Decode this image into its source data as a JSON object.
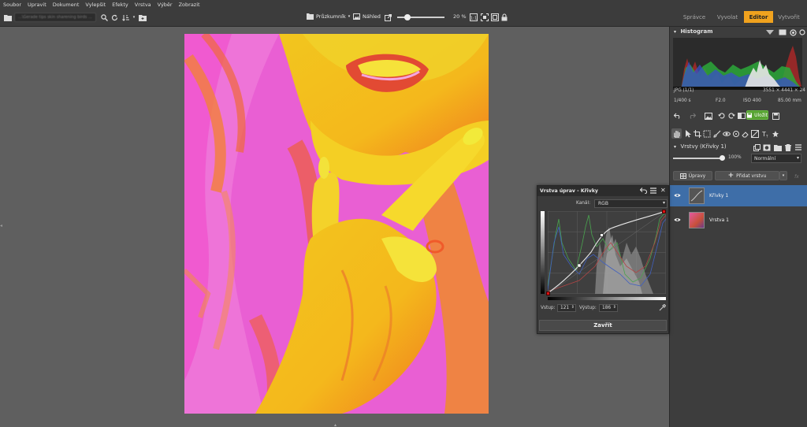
{
  "menu": [
    "Soubor",
    "Upravit",
    "Dokument",
    "Vylepšit",
    "Efekty",
    "Vrstva",
    "Výběr",
    "Zobrazit"
  ],
  "toolbar": {
    "search_value": "...\\Gerade tips skin sharening birds ...",
    "browser_label": "Průzkumník",
    "preview_label": "Náhled",
    "zoom": "20 %"
  },
  "tabs": [
    {
      "label": "Správce",
      "active": false
    },
    {
      "label": "Vyvolat",
      "active": false
    },
    {
      "label": "Editor",
      "active": true
    },
    {
      "label": "Vytvořit",
      "active": false
    }
  ],
  "histogram": {
    "title": "Histogram",
    "format": "JPG (1/1)",
    "dimensions": "3551 × 4441 × 24",
    "shutter": "1/400 s",
    "aperture": "F2.0",
    "iso": "ISO 400",
    "focal": "85.00 mm"
  },
  "actions": {
    "save_label": "Uložit"
  },
  "layers": {
    "title": "Vrstvy (Křivky 1)",
    "opacity": "100%",
    "blend_mode": "Normální",
    "adjust_label": "Úpravy",
    "add_label": "Přidat vrstvu",
    "items": [
      {
        "name": "Křivky 1",
        "selected": true
      },
      {
        "name": "Vrstva 1",
        "selected": false
      }
    ]
  },
  "curves": {
    "title": "Vrstva úprav - Křivky",
    "channel_label": "Kanál:",
    "channel_value": "RGB",
    "input_label": "Vstup:",
    "input_value": "121",
    "output_label": "Výstup:",
    "output_value": "186",
    "close_label": "Zavřít"
  },
  "colors": {
    "accent": "#f0a21e",
    "save_green": "#57a332",
    "selection_blue": "#3e6ea8"
  }
}
